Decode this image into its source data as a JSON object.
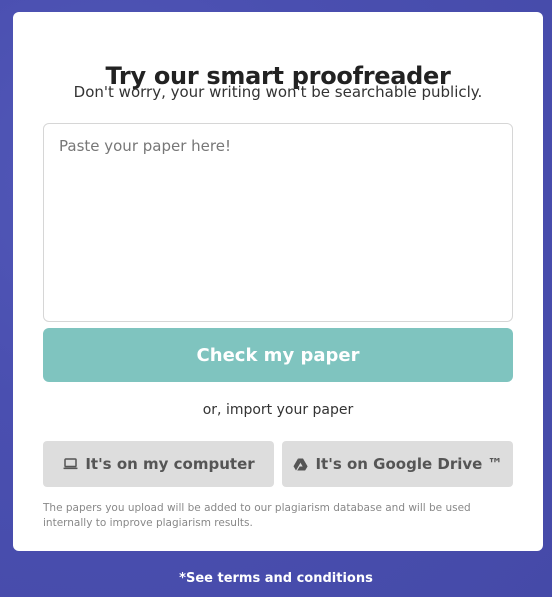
{
  "header": {
    "title": "Try our smart proofreader",
    "subtitle": "Don't worry, your writing won't be searchable publicly."
  },
  "editor": {
    "placeholder": "Paste your paper here!",
    "value": ""
  },
  "actions": {
    "check_label": "Check my paper",
    "import_prompt": "or, import your paper",
    "import_computer_label": "It's on my computer",
    "import_computer_icon": "laptop-icon",
    "import_drive_label": "It's on Google Drive ™",
    "import_drive_icon": "google-drive-icon"
  },
  "disclaimer": "The papers you upload will be added to our plagiarism database and will be used internally to improve plagiarism results.",
  "footer": {
    "terms_label": "*See terms and conditions"
  },
  "colors": {
    "background": "#4a4fb0",
    "check_button": "#7fc4bf",
    "import_button": "#dddddd"
  }
}
